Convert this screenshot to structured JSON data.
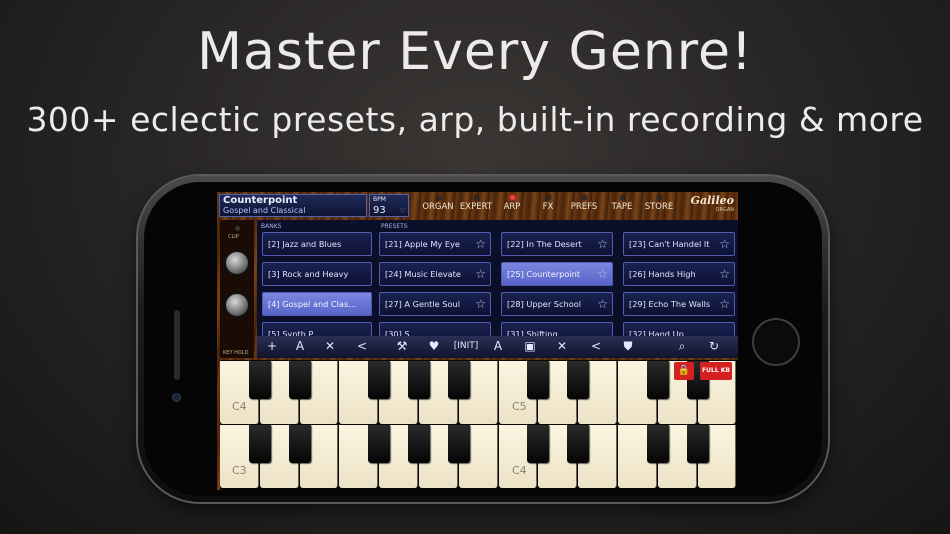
{
  "promo": {
    "headline": "Master Every Genre!",
    "subline": "300+ eclectic presets, arp, built-in recording & more"
  },
  "app": {
    "current_preset": "Counterpoint",
    "current_bank": "Gospel and Classical",
    "bpm_label": "BPM",
    "bpm_value": "93",
    "logo": "Galileo",
    "logo_sub": "ORGAN",
    "nav": [
      {
        "label": "ORGAN",
        "led_on": false
      },
      {
        "label": "EXPERT",
        "led_on": false
      },
      {
        "label": "ARP",
        "led_on": true
      },
      {
        "label": "FX",
        "led_on": false
      },
      {
        "label": "PREFS",
        "led_on": false
      },
      {
        "label": "TAPE",
        "led_on": false
      },
      {
        "label": "STORE",
        "led_on": false
      }
    ],
    "left_panel": {
      "clip": "CLIP",
      "key_hold": "KEY HOLD"
    },
    "banks_header": "BANKS",
    "presets_header": "PRESETS",
    "banks": [
      "[2] Jazz and Blues",
      "[3] Rock and Heavy",
      "[4] Gospel and Clas...",
      "[5] Synth P..."
    ],
    "selected_bank": 2,
    "presets": [
      "[21] Apple My Eye",
      "[22] In The Desert",
      "[23] Can't Handel It",
      "[24] Music Elevate",
      "[25] Counterpoint",
      "[26] Hands High",
      "[27] A Gentle Soul",
      "[28] Upper School",
      "[29] Echo The Walls",
      "[30] S...",
      "[31] Shifting",
      "[32] Hand Up"
    ],
    "selected_preset": 4,
    "toolbar": {
      "add": "+",
      "rename": "A",
      "delete": "✕",
      "share": "<",
      "init": "[INIT]",
      "search": "⌕",
      "refresh": "↻"
    },
    "keyboard": {
      "upper_labels": [
        "C4",
        "C5"
      ],
      "lower_labels": [
        "C3",
        "C4"
      ],
      "lock_label": "🔒",
      "full_kb_label": "FULL KB"
    }
  }
}
